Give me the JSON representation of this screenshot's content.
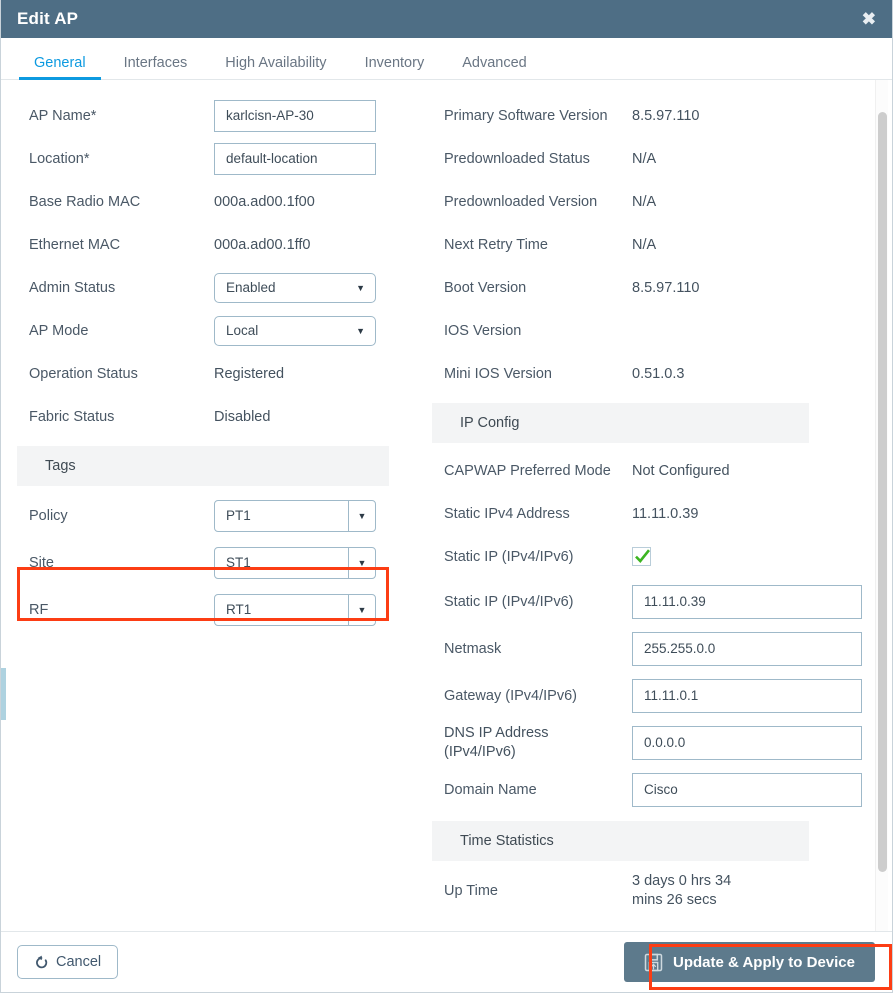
{
  "window": {
    "title": "Edit AP",
    "close_icon": "close-icon",
    "close_glyph": "✖"
  },
  "tabs": [
    {
      "label": "General",
      "active": true
    },
    {
      "label": "Interfaces",
      "active": false
    },
    {
      "label": "High Availability",
      "active": false
    },
    {
      "label": "Inventory",
      "active": false
    },
    {
      "label": "Advanced",
      "active": false
    }
  ],
  "left": {
    "ap_name": {
      "label": "AP Name*",
      "value": "karlcisn-AP-30"
    },
    "location": {
      "label": "Location*",
      "value": "default-location"
    },
    "base_radio_mac": {
      "label": "Base Radio MAC",
      "value": "000a.ad00.1f00"
    },
    "ethernet_mac": {
      "label": "Ethernet MAC",
      "value": "000a.ad00.1ff0"
    },
    "admin_status": {
      "label": "Admin Status",
      "value": "Enabled"
    },
    "ap_mode": {
      "label": "AP Mode",
      "value": "Local"
    },
    "operation_status": {
      "label": "Operation Status",
      "value": "Registered"
    },
    "fabric_status": {
      "label": "Fabric Status",
      "value": "Disabled"
    },
    "tags_band": "Tags",
    "policy": {
      "label": "Policy",
      "value": "PT1"
    },
    "site": {
      "label": "Site",
      "value": "ST1"
    },
    "rf": {
      "label": "RF",
      "value": "RT1"
    }
  },
  "right": {
    "primary_software_version": {
      "label": "Primary Software Version",
      "value": "8.5.97.110"
    },
    "predownloaded_status": {
      "label": "Predownloaded Status",
      "value": "N/A"
    },
    "predownloaded_version": {
      "label": "Predownloaded Version",
      "value": "N/A"
    },
    "next_retry_time": {
      "label": "Next Retry Time",
      "value": "N/A"
    },
    "boot_version": {
      "label": "Boot Version",
      "value": "8.5.97.110"
    },
    "ios_version": {
      "label": "IOS Version",
      "value": ""
    },
    "mini_ios_version": {
      "label": "Mini IOS Version",
      "value": "0.51.0.3"
    },
    "ip_config_band": "IP Config",
    "capwap_preferred_mode": {
      "label": "CAPWAP Preferred Mode",
      "value": "Not Configured"
    },
    "static_ipv4_address": {
      "label": "Static IPv4 Address",
      "value": "11.11.0.39"
    },
    "static_ip_checkbox": {
      "label": "Static IP (IPv4/IPv6)",
      "checked": true
    },
    "static_ip_field": {
      "label": "Static IP (IPv4/IPv6)",
      "value": "11.11.0.39"
    },
    "netmask": {
      "label": "Netmask",
      "value": "255.255.0.0"
    },
    "gateway": {
      "label": "Gateway (IPv4/IPv6)",
      "value": "11.11.0.1"
    },
    "dns_ip_line1": "DNS IP Address",
    "dns_ip_line2": "(IPv4/IPv6)",
    "dns_ip": {
      "value": "0.0.0.0"
    },
    "domain_name": {
      "label": "Domain Name",
      "value": "Cisco"
    },
    "time_statistics_band": "Time Statistics",
    "up_time": {
      "label": "Up Time",
      "line1": "3 days 0 hrs 34",
      "line2": "mins 26 secs"
    }
  },
  "footer": {
    "cancel_label": "Cancel",
    "cancel_icon": "undo-icon",
    "update_label": "Update & Apply to Device",
    "update_icon": "save-icon"
  },
  "colors": {
    "titlebar": "#4e6e85",
    "accent_tab": "#0d9ae0",
    "highlight": "#fc3d14",
    "primary_button": "#5d7a8c",
    "band": "#f3f4f5",
    "check_green": "#3cb521"
  },
  "dropdown_caret_glyph": "▼"
}
